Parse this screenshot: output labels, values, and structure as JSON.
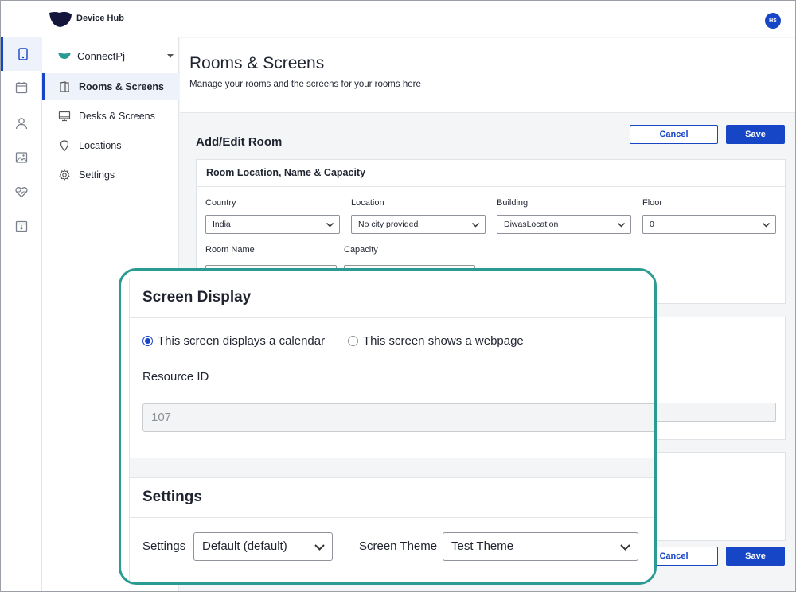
{
  "app": {
    "name": "Device Hub",
    "user_initials": "HS"
  },
  "colors": {
    "accent": "#1646c6",
    "highlight_ring": "#2a9b92",
    "org_mark": "#2a9b92"
  },
  "rail": [
    {
      "icon": "tablet-icon",
      "active": true
    },
    {
      "icon": "calendar-icon",
      "active": false
    },
    {
      "icon": "user-icon",
      "active": false
    },
    {
      "icon": "image-icon",
      "active": false
    },
    {
      "icon": "heart-pulse-icon",
      "active": false
    },
    {
      "icon": "calendar-download-icon",
      "active": false
    }
  ],
  "subnav": {
    "org": "ConnectPj",
    "items": [
      {
        "label": "Rooms & Screens",
        "icon": "door-icon",
        "active": true
      },
      {
        "label": "Desks & Screens",
        "icon": "monitor-icon",
        "active": false
      },
      {
        "label": "Locations",
        "icon": "map-pin-icon",
        "active": false
      },
      {
        "label": "Settings",
        "icon": "gear-icon",
        "active": false
      }
    ]
  },
  "header": {
    "title": "Rooms & Screens",
    "subtitle": "Manage your rooms and the screens for your rooms here"
  },
  "form": {
    "section_title": "Add/Edit Room",
    "cancel_label": "Cancel",
    "save_label": "Save",
    "location_card": {
      "title": "Room Location, Name & Capacity",
      "country_label": "Country",
      "country_value": "India",
      "location_label": "Location",
      "location_value": "No city provided",
      "building_label": "Building",
      "building_value": "DiwasLocation",
      "floor_label": "Floor",
      "floor_value": "0",
      "room_name_label": "Room Name",
      "capacity_label": "Capacity"
    }
  },
  "zoom": {
    "screen_display": {
      "title": "Screen Display",
      "option_calendar": "This screen displays a calendar",
      "option_webpage": "This screen shows a webpage",
      "selected": "calendar",
      "resource_id_label": "Resource ID",
      "resource_id_value": "107"
    },
    "settings": {
      "title": "Settings",
      "settings_label": "Settings",
      "settings_value": "Default (default)",
      "theme_label": "Screen Theme",
      "theme_value": "Test Theme"
    }
  }
}
